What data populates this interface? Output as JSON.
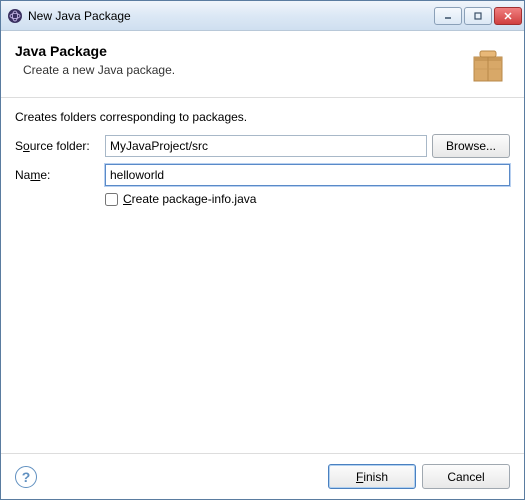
{
  "window": {
    "title": "New Java Package"
  },
  "header": {
    "title": "Java Package",
    "subtitle": "Create a new Java package."
  },
  "content": {
    "description": "Creates folders corresponding to packages.",
    "source_folder_label": "Source folder:",
    "source_folder_value": "MyJavaProject/src",
    "browse_label": "Browse...",
    "name_label": "Name:",
    "name_value": "helloworld",
    "checkbox_label": "Create package-info.java",
    "checkbox_checked": false
  },
  "footer": {
    "finish_label": "Finish",
    "cancel_label": "Cancel"
  }
}
